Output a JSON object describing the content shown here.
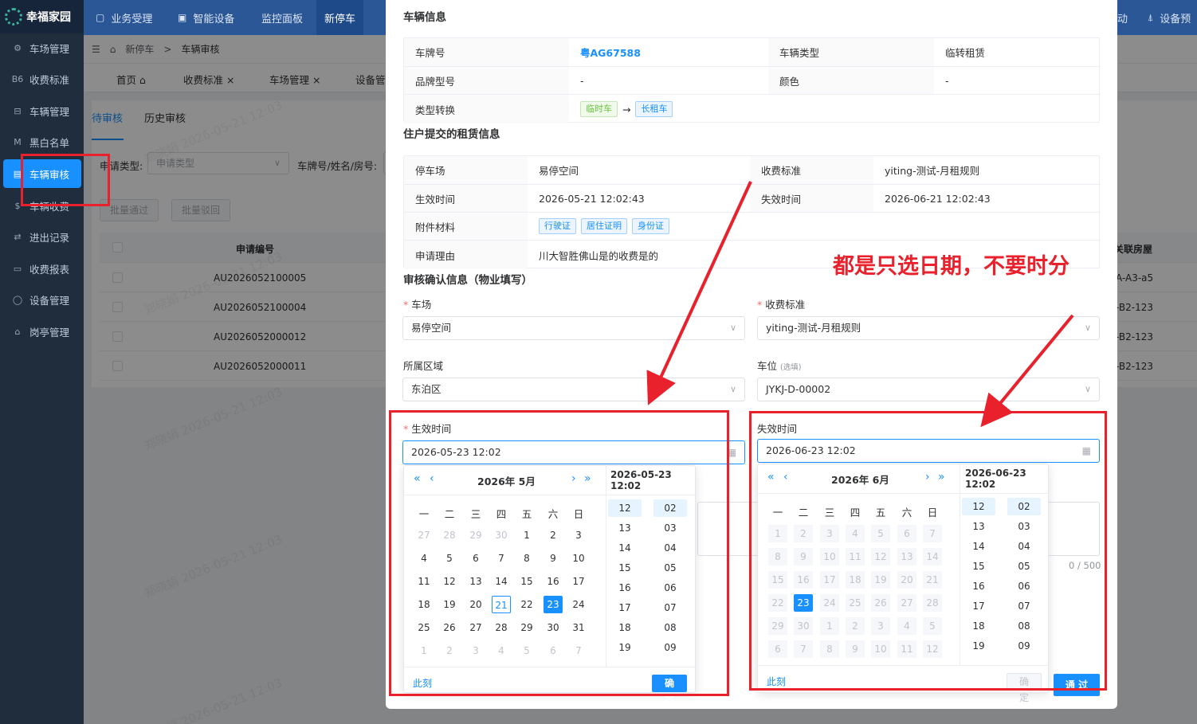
{
  "sidebar": {
    "logo": "幸福家园",
    "items": [
      {
        "label": "车场管理",
        "icon": "car-park-icon"
      },
      {
        "label": "收费标准",
        "icon": "fee-icon"
      },
      {
        "label": "车辆管理",
        "icon": "vehicle-icon"
      },
      {
        "label": "黑白名单",
        "icon": "list-icon"
      },
      {
        "label": "车辆审核",
        "icon": "audit-icon"
      },
      {
        "label": "车辆收费",
        "icon": "charge-icon"
      },
      {
        "label": "进出记录",
        "icon": "record-icon"
      },
      {
        "label": "收费报表",
        "icon": "report-icon"
      },
      {
        "label": "设备管理",
        "icon": "device-icon"
      },
      {
        "label": "岗亭管理",
        "icon": "booth-icon"
      }
    ]
  },
  "topnav": {
    "items": [
      "业务受理",
      "智能设备",
      "监控面板",
      "新停车"
    ],
    "right_items": [
      "动",
      "设备预"
    ]
  },
  "breadcrumb": {
    "parent": "新停车",
    "sep": ">",
    "current": "车辆审核"
  },
  "tags": [
    {
      "label": "首页",
      "closable": false
    },
    {
      "label": "收费标准",
      "closable": true
    },
    {
      "label": "车场管理",
      "closable": true
    },
    {
      "label": "设备管",
      "closable": false
    }
  ],
  "page": {
    "subtabs": [
      "待审核",
      "历史审核"
    ],
    "filter_type_label": "申请类型:",
    "filter_type_placeholder": "申请类型",
    "filter_plate_label": "车牌号/姓名/房号:",
    "batch_pass": "批量通过",
    "batch_reject": "批量驳回",
    "col_apply_no": "申请编号",
    "col_room": "关联房屋",
    "rows": [
      {
        "no": "AU2026052100005",
        "room": "A-A3-a5"
      },
      {
        "no": "AU2026052100004",
        "room": "-B2-123"
      },
      {
        "no": "AU2026052000012",
        "room": "-B2-123"
      },
      {
        "no": "AU2026052000011",
        "room": "-B2-123"
      }
    ],
    "watermark": "郑晓娟 2026-05-21 12:03"
  },
  "dialog": {
    "vehicle_title": "车辆信息",
    "vehicle": {
      "plate_label": "车牌号",
      "plate": "粤AG67588",
      "type_label": "车辆类型",
      "type": "临转租赁",
      "brand_label": "品牌型号",
      "brand": "-",
      "color_label": "颜色",
      "color": "-",
      "conv_label": "类型转换",
      "conv_from": "临时车",
      "conv_arrow": "→",
      "conv_to": "长租车"
    },
    "rent_title": "住户提交的租赁信息",
    "rent": {
      "lot_label": "停车场",
      "lot": "易停空间",
      "std_label": "收费标准",
      "std": "yiting-测试-月租规则",
      "start_label": "生效时间",
      "start": "2026-05-21 12:02:43",
      "end_label": "失效时间",
      "end": "2026-06-21 12:02:43",
      "attach_label": "附件材料",
      "attachments": [
        "行驶证",
        "居住证明",
        "身份证"
      ],
      "reason_label": "申请理由",
      "reason": "川大智胜佛山是的收费是的"
    },
    "confirm_title": "审核确认信息（物业填写）",
    "form": {
      "lot_label": "车场",
      "lot_value": "易停空间",
      "std_label": "收费标准",
      "std_value": "yiting-测试-月租规则",
      "area_label": "所属区域",
      "area_value": "东泊区",
      "space_label": "车位",
      "space_opt": "(选填)",
      "space_value": "JYKJ-D-00002",
      "start_label": "生效时间",
      "start_value": "2026-05-23 12:02",
      "end_label": "失效时间",
      "end_value": "2026-06-23 12:02",
      "counter": "0 / 500",
      "pass_button": "通 过"
    }
  },
  "picker_start": {
    "year_month": "2026年  5月",
    "value": "2026-05-23 12:02",
    "weekdays": [
      "一",
      "二",
      "三",
      "四",
      "五",
      "六",
      "日"
    ],
    "days": [
      [
        "27",
        "28",
        "29",
        "30",
        "1",
        "2",
        "3"
      ],
      [
        "4",
        "5",
        "6",
        "7",
        "8",
        "9",
        "10"
      ],
      [
        "11",
        "12",
        "13",
        "14",
        "15",
        "16",
        "17"
      ],
      [
        "18",
        "19",
        "20",
        "21",
        "22",
        "23",
        "24"
      ],
      [
        "25",
        "26",
        "27",
        "28",
        "29",
        "30",
        "31"
      ],
      [
        "1",
        "2",
        "3",
        "4",
        "5",
        "6",
        "7"
      ]
    ],
    "hours": [
      "12",
      "13",
      "14",
      "15",
      "16",
      "17",
      "18",
      "19"
    ],
    "minutes": [
      "02",
      "03",
      "04",
      "05",
      "06",
      "07",
      "08",
      "09"
    ],
    "now": "此刻",
    "ok": "确 定"
  },
  "picker_end": {
    "year_month": "2026年  6月",
    "value": "2026-06-23 12:02",
    "weekdays": [
      "一",
      "二",
      "三",
      "四",
      "五",
      "六",
      "日"
    ],
    "days": [
      [
        "1",
        "2",
        "3",
        "4",
        "5",
        "6",
        "7"
      ],
      [
        "8",
        "9",
        "10",
        "11",
        "12",
        "13",
        "14"
      ],
      [
        "15",
        "16",
        "17",
        "18",
        "19",
        "20",
        "21"
      ],
      [
        "22",
        "23",
        "24",
        "25",
        "26",
        "27",
        "28"
      ],
      [
        "29",
        "30",
        "1",
        "2",
        "3",
        "4",
        "5"
      ],
      [
        "6",
        "7",
        "8",
        "9",
        "10",
        "11",
        "12"
      ]
    ],
    "hours": [
      "12",
      "13",
      "14",
      "15",
      "16",
      "17",
      "18",
      "19"
    ],
    "minutes": [
      "02",
      "03",
      "04",
      "05",
      "06",
      "07",
      "08",
      "09"
    ],
    "now": "此刻",
    "ok": "确 定"
  },
  "annotation": {
    "text": "都是只选日期，不要时分",
    "color": "#e8212c"
  },
  "colors": {
    "primary": "#1890ff",
    "sidebar": "#1f2d3d",
    "topnav": "#2b5797",
    "annotation": "#e8212c"
  }
}
